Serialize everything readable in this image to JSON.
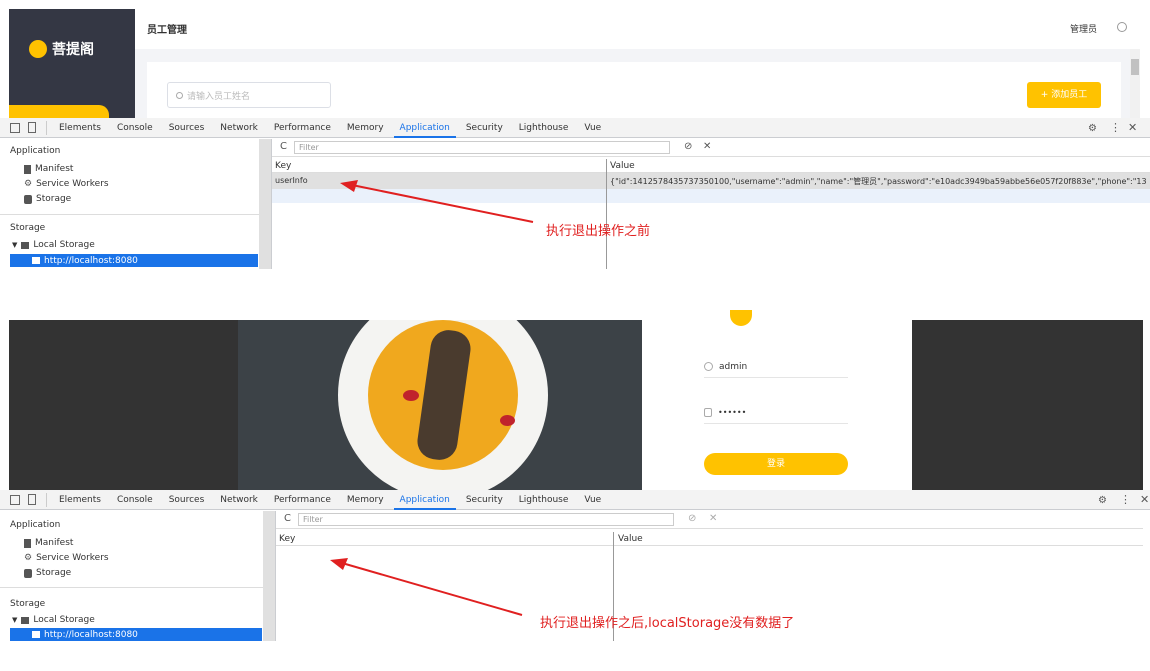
{
  "top_app": {
    "logo_text": "菩提阁",
    "page_title": "员工管理",
    "user_label": "管理员",
    "search_placeholder": "请输入员工姓名",
    "add_button": "+ 添加员工"
  },
  "devtools_tabs": [
    "Elements",
    "Console",
    "Sources",
    "Network",
    "Performance",
    "Memory",
    "Application",
    "Security",
    "Lighthouse",
    "Vue"
  ],
  "sidebar": {
    "application_heading": "Application",
    "items": [
      "Manifest",
      "Service Workers",
      "Storage"
    ],
    "storage_heading": "Storage",
    "local_storage": "Local Storage",
    "origin": "http://localhost:8080"
  },
  "table": {
    "filter_placeholder": "Filter",
    "key_header": "Key",
    "value_header": "Value",
    "row_key": "userInfo",
    "row_value": "{\"id\":1412578435737350100,\"username\":\"admin\",\"name\":\"管理员\",\"password\":\"e10adc3949ba59abbe56e057f20f883e\",\"phone\":\"13..."
  },
  "login": {
    "username": "admin",
    "password": "••••••",
    "button": "登录"
  },
  "annotations": {
    "before": "执行退出操作之前",
    "after": "执行退出操作之后,localStorage没有数据了"
  },
  "colors": {
    "accent": "#ffc200",
    "devtools_blue": "#1a73e8",
    "dark": "#343744",
    "arrow": "#e02020"
  }
}
